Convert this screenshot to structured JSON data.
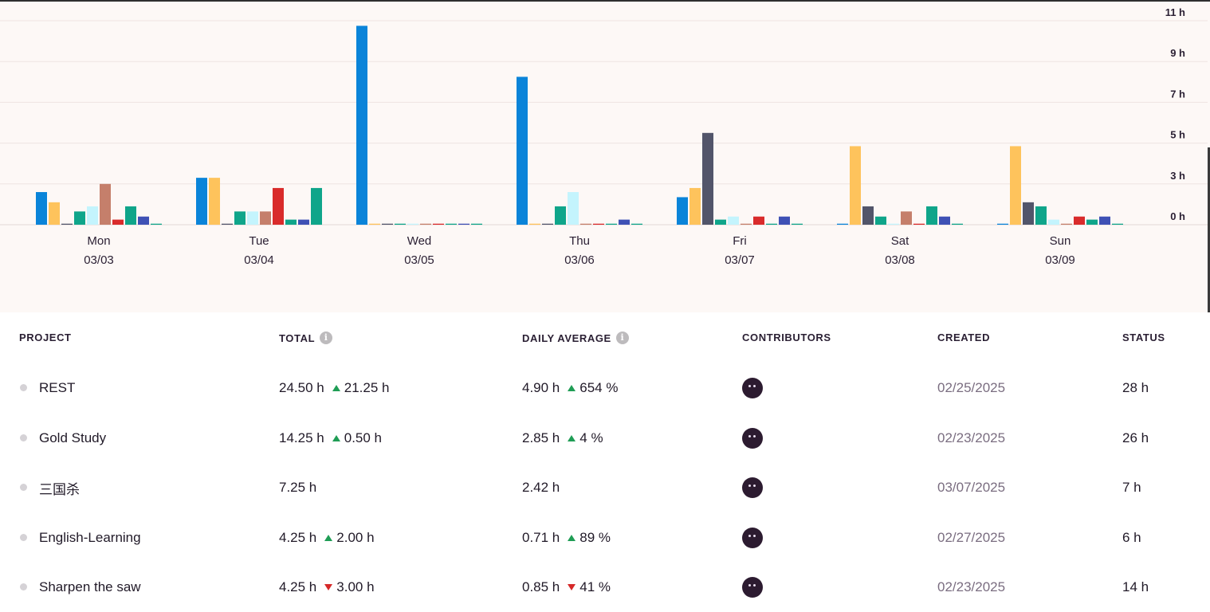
{
  "chart_data": {
    "type": "bar",
    "categories": [
      "Mon",
      "Tue",
      "Wed",
      "Thu",
      "Fri",
      "Sat",
      "Sun"
    ],
    "dates": [
      "03/03",
      "03/04",
      "03/05",
      "03/06",
      "03/07",
      "03/08",
      "03/09"
    ],
    "y_ticks": [
      "11 h",
      "9 h",
      "7 h",
      "5 h",
      "3 h",
      "0 h"
    ],
    "ylim": [
      0,
      10
    ],
    "grid": true,
    "series": [
      {
        "color": "#0a84d9",
        "values": [
          1.6,
          2.3,
          9.75,
          7.25,
          1.35,
          0.05,
          0.05
        ]
      },
      {
        "color": "#fec35c",
        "values": [
          1.1,
          2.3,
          0.05,
          0.05,
          1.8,
          3.85,
          3.85
        ]
      },
      {
        "color": "#52556a",
        "values": [
          0.05,
          0.05,
          0.05,
          0.05,
          4.5,
          0.9,
          1.1
        ]
      },
      {
        "color": "#0fa58a",
        "values": [
          0.65,
          0.65,
          0.05,
          0.9,
          0.25,
          0.4,
          0.9
        ]
      },
      {
        "color": "#c4f4fd",
        "values": [
          0.9,
          0.65,
          0.05,
          1.6,
          0.4,
          0.05,
          0.25
        ]
      },
      {
        "color": "#c57f6b",
        "values": [
          2.0,
          0.65,
          0.05,
          0.05,
          0.05,
          0.65,
          0.05
        ]
      },
      {
        "color": "#d92b2b",
        "values": [
          0.25,
          1.8,
          0.05,
          0.05,
          0.4,
          0.05,
          0.4
        ]
      },
      {
        "color": "#0fa58a",
        "values": [
          0.9,
          0.25,
          0.05,
          0.05,
          0.05,
          0.9,
          0.25
        ]
      },
      {
        "color": "#3f51b5",
        "values": [
          0.4,
          0.25,
          0.05,
          0.25,
          0.4,
          0.4,
          0.4
        ]
      },
      {
        "color": "#0fa58a",
        "values": [
          0.05,
          1.8,
          0.05,
          0.05,
          0.05,
          0.05,
          0.05
        ]
      }
    ]
  },
  "table": {
    "headers": {
      "project": "PROJECT",
      "total": "TOTAL",
      "daily_average": "DAILY AVERAGE",
      "contributors": "CONTRIBUTORS",
      "created": "CREATED",
      "status": "STATUS"
    },
    "info_icon": "info-icon",
    "rows": [
      {
        "name": "REST",
        "total": "24.50 h",
        "total_delta": "21.25 h",
        "total_dir": "up",
        "avg": "4.90 h",
        "avg_delta": "654 %",
        "avg_dir": "up",
        "created": "02/25/2025",
        "status": "28 h"
      },
      {
        "name": "Gold Study",
        "total": "14.25 h",
        "total_delta": "0.50 h",
        "total_dir": "up",
        "avg": "2.85 h",
        "avg_delta": "4 %",
        "avg_dir": "up",
        "created": "02/23/2025",
        "status": "26 h"
      },
      {
        "name": "三国杀",
        "total": "7.25 h",
        "total_delta": "",
        "total_dir": "",
        "avg": "2.42 h",
        "avg_delta": "",
        "avg_dir": "",
        "created": "03/07/2025",
        "status": "7 h"
      },
      {
        "name": "English-Learning",
        "total": "4.25 h",
        "total_delta": "2.00 h",
        "total_dir": "up",
        "avg": "0.71 h",
        "avg_delta": "89 %",
        "avg_dir": "up",
        "created": "02/27/2025",
        "status": "6 h"
      },
      {
        "name": "Sharpen the saw",
        "total": "4.25 h",
        "total_delta": "3.00 h",
        "total_dir": "down",
        "avg": "0.85 h",
        "avg_delta": "41 %",
        "avg_dir": "down",
        "created": "02/23/2025",
        "status": "14 h"
      }
    ]
  }
}
